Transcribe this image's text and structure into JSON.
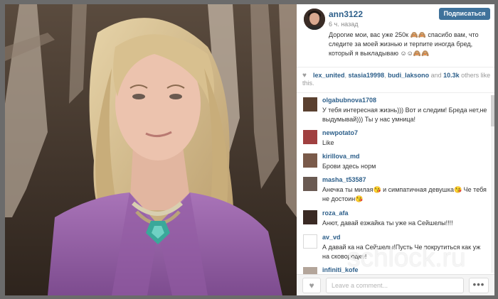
{
  "post": {
    "username": "ann3122",
    "time": "6 ч. назад",
    "caption": "Дорогие мои, вас уже 250к 🙈🙈 спасибо вам, что следите за моей жизнью и терпите иногда бред, который я выкладываю ☺☺🙈🙈",
    "follow_label": "Подписаться"
  },
  "likes": {
    "icon": "heart-icon",
    "users": [
      "lex_united",
      "stasia19998",
      "budi_laksono"
    ],
    "sep1": ", ",
    "sep2": ", ",
    "and_text": " and ",
    "count": "10.3k",
    "suffix": " others like this."
  },
  "comments": [
    {
      "user": "olgabubnova1708",
      "text": "У тебя интересная жизнь))) Вот и следим! Бреда нет,не выдумывай))) Ты у нас умница!"
    },
    {
      "user": "newpotato7",
      "text": "Like"
    },
    {
      "user": "kirillova_md",
      "text": "Брови здесь норм"
    },
    {
      "user": "masha_t53587",
      "text": "Анечка ты милая😘 и симпатичная девушка😘 Че тебя не достоин😘"
    },
    {
      "user": "roza_afa",
      "text": "Анют, давай езжайка ты уже на Сейшелы!!!!"
    },
    {
      "user": "av_vd",
      "text": "А давай ка на Сейшелы!Пусть Че покрутиться как уж на сковородке!"
    },
    {
      "user": "infiniti_kofe",
      "text": ""
    }
  ],
  "footer": {
    "comment_placeholder": "Leave a comment...",
    "like_icon": "heart-icon",
    "more_label": "•••"
  },
  "watermark": "schlock.ru"
}
